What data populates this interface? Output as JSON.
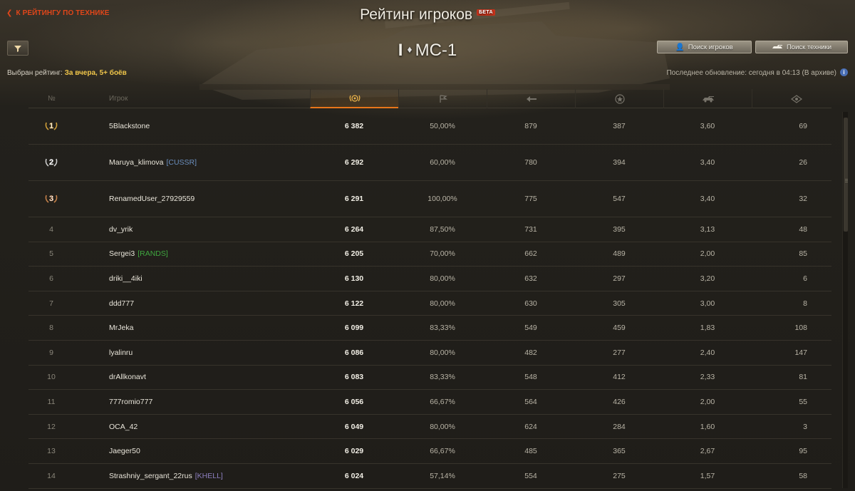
{
  "header": {
    "back_label": "К РЕЙТИНГУ ПО ТЕХНИКЕ",
    "title": "Рейтинг игроков",
    "beta": "БЕТА",
    "vehicle_tier": "I",
    "vehicle_name": "МС-1",
    "search_players_label": "Поиск игроков",
    "search_vehicles_label": "Поиск техники"
  },
  "filters": {
    "selected_prefix": "Выбран рейтинг:",
    "selected_value": "За вчера, 5+ боёв",
    "last_update": "Последнее обновление: сегодня в 04:13 (В архиве)"
  },
  "table": {
    "num_header": "№",
    "player_header": "Игрок",
    "rows": [
      {
        "place": "1",
        "name": "5Blackstone",
        "clan": "",
        "clan_color": "",
        "rating": "6 382",
        "wins": "50,00%",
        "damage": "879",
        "xp": "387",
        "frags": "3,60",
        "spot": "69"
      },
      {
        "place": "2",
        "name": "Maruya_klimova",
        "clan": "[CUSSR]",
        "clan_color": "#6b8fbf",
        "rating": "6 292",
        "wins": "60,00%",
        "damage": "780",
        "xp": "394",
        "frags": "3,40",
        "spot": "26"
      },
      {
        "place": "3",
        "name": "RenamedUser_27929559",
        "clan": "",
        "clan_color": "",
        "rating": "6 291",
        "wins": "100,00%",
        "damage": "775",
        "xp": "547",
        "frags": "3,40",
        "spot": "32"
      },
      {
        "place": "4",
        "name": "dv_yrik",
        "clan": "",
        "clan_color": "",
        "rating": "6 264",
        "wins": "87,50%",
        "damage": "731",
        "xp": "395",
        "frags": "3,13",
        "spot": "48"
      },
      {
        "place": "5",
        "name": "Sergei3",
        "clan": "[RANDS]",
        "clan_color": "#3fa63f",
        "rating": "6 205",
        "wins": "70,00%",
        "damage": "662",
        "xp": "489",
        "frags": "2,00",
        "spot": "85"
      },
      {
        "place": "6",
        "name": "driki__4iki",
        "clan": "",
        "clan_color": "",
        "rating": "6 130",
        "wins": "80,00%",
        "damage": "632",
        "xp": "297",
        "frags": "3,20",
        "spot": "6"
      },
      {
        "place": "7",
        "name": "ddd777",
        "clan": "",
        "clan_color": "",
        "rating": "6 122",
        "wins": "80,00%",
        "damage": "630",
        "xp": "305",
        "frags": "3,00",
        "spot": "8"
      },
      {
        "place": "8",
        "name": "MrJeka",
        "clan": "",
        "clan_color": "",
        "rating": "6 099",
        "wins": "83,33%",
        "damage": "549",
        "xp": "459",
        "frags": "1,83",
        "spot": "108"
      },
      {
        "place": "9",
        "name": "lyalinru",
        "clan": "",
        "clan_color": "",
        "rating": "6 086",
        "wins": "80,00%",
        "damage": "482",
        "xp": "277",
        "frags": "2,40",
        "spot": "147"
      },
      {
        "place": "10",
        "name": "drAllkonavt",
        "clan": "",
        "clan_color": "",
        "rating": "6 083",
        "wins": "83,33%",
        "damage": "548",
        "xp": "412",
        "frags": "2,33",
        "spot": "81"
      },
      {
        "place": "11",
        "name": "777romio777",
        "clan": "",
        "clan_color": "",
        "rating": "6 056",
        "wins": "66,67%",
        "damage": "564",
        "xp": "426",
        "frags": "2,00",
        "spot": "55"
      },
      {
        "place": "12",
        "name": "OCA_42",
        "clan": "",
        "clan_color": "",
        "rating": "6 049",
        "wins": "80,00%",
        "damage": "624",
        "xp": "284",
        "frags": "1,60",
        "spot": "3"
      },
      {
        "place": "13",
        "name": "Jaeger50",
        "clan": "",
        "clan_color": "",
        "rating": "6 029",
        "wins": "66,67%",
        "damage": "485",
        "xp": "365",
        "frags": "2,67",
        "spot": "95"
      },
      {
        "place": "14",
        "name": "Strashniy_sergant_22rus",
        "clan": "[KHELL]",
        "clan_color": "#8d7fbf",
        "rating": "6 024",
        "wins": "57,14%",
        "damage": "554",
        "xp": "275",
        "frags": "1,57",
        "spot": "58"
      }
    ]
  },
  "icons": {
    "rating": "laurel-rating-icon",
    "wins": "flag-icon",
    "damage": "damage-icon",
    "xp": "star-icon",
    "frags": "tank-destroyed-icon",
    "spot": "spotted-icon"
  },
  "colors": {
    "accent": "#e8761a",
    "back_link": "#e0461a",
    "selected_rating": "#f0c64a",
    "gold": "#d4a23a",
    "silver": "#cfcfcf",
    "bronze": "#c7824a"
  }
}
